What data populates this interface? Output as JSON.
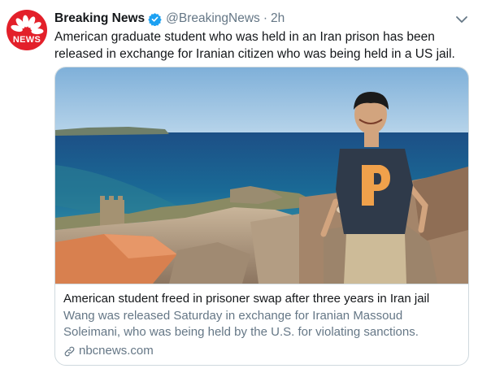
{
  "tweet": {
    "display_name": "Breaking News",
    "handle": "@BreakingNews",
    "separator": "·",
    "time": "2h",
    "text": "American graduate student who was held in an Iran prison has been released in exchange for Iranian citizen who was being held in a US jail.",
    "avatar_label": "NEWS"
  },
  "card": {
    "title": "American student freed in prisoner swap after three years in Iran jail",
    "description": "Wang was released Saturday in exchange for Iranian Massoud Soleimani, who was being held by the U.S. for violating sanctions.",
    "domain": "nbcnews.com",
    "image_icon": "photo-man-at-castle-overlooking-sea"
  },
  "icons": {
    "verified": "verified-badge-icon",
    "caret": "chevron-down-icon",
    "link": "link-icon"
  },
  "colors": {
    "brand_red": "#e3202a",
    "verified_blue": "#1da1f2",
    "text_primary": "#14171a",
    "text_secondary": "#657786",
    "border": "#cfd9de"
  }
}
